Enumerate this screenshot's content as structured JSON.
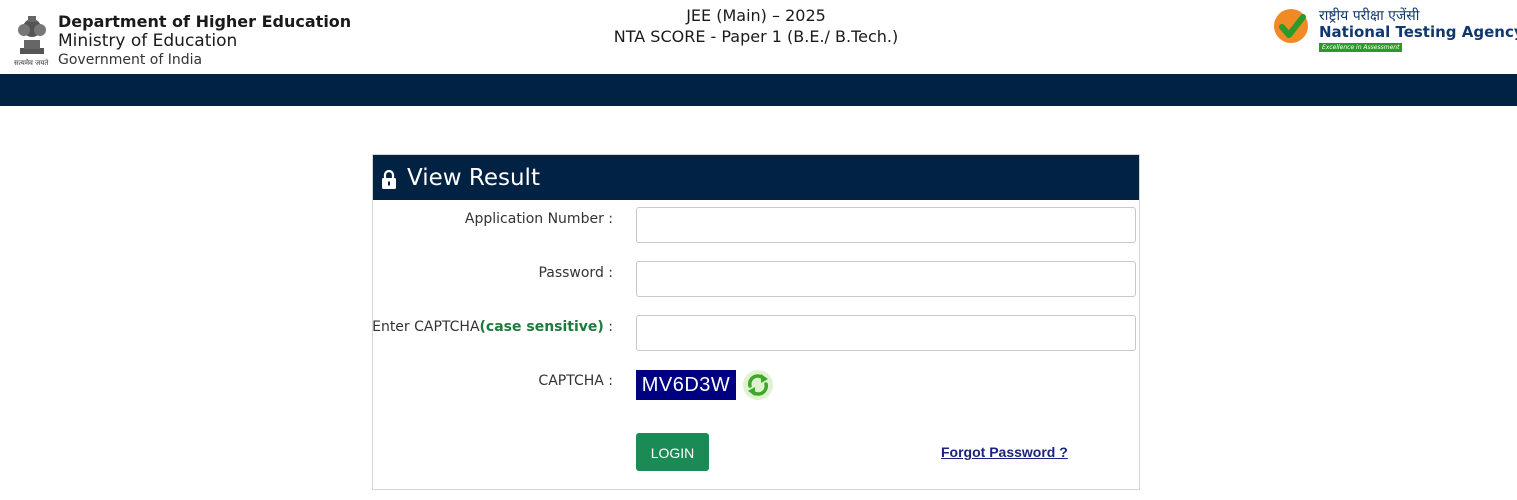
{
  "header": {
    "department": "Department of Higher Education",
    "ministry": "Ministry of Education",
    "government": "Government of India",
    "emblem_motto": "सत्यमेव जयते",
    "exam_title": "JEE (Main) – 2025",
    "exam_subtitle": "NTA SCORE - Paper 1 (B.E./ B.Tech.)",
    "nta_hindi": "राष्ट्रीय परीक्षा एजेंसी",
    "nta_english": "National Testing Agency",
    "nta_tagline": "Excellence in Assessment"
  },
  "form": {
    "title": "View Result",
    "application_label": "Application Number :",
    "application_value": "",
    "password_label": "Password :",
    "password_value": "",
    "captcha_input_label_prefix": "Enter CAPTCHA",
    "captcha_input_label_hint": "(case sensitive)",
    "captcha_input_label_suffix": " :",
    "captcha_input_value": "",
    "captcha_label": "CAPTCHA :",
    "captcha_code": "MV6D3W",
    "login_label": "LOGIN",
    "forgot_label": "Forgot Password ?"
  },
  "colors": {
    "navy": "#022244",
    "login_green": "#1c8a55",
    "captcha_bg": "#000080",
    "hint_green": "#1d7a3d"
  }
}
